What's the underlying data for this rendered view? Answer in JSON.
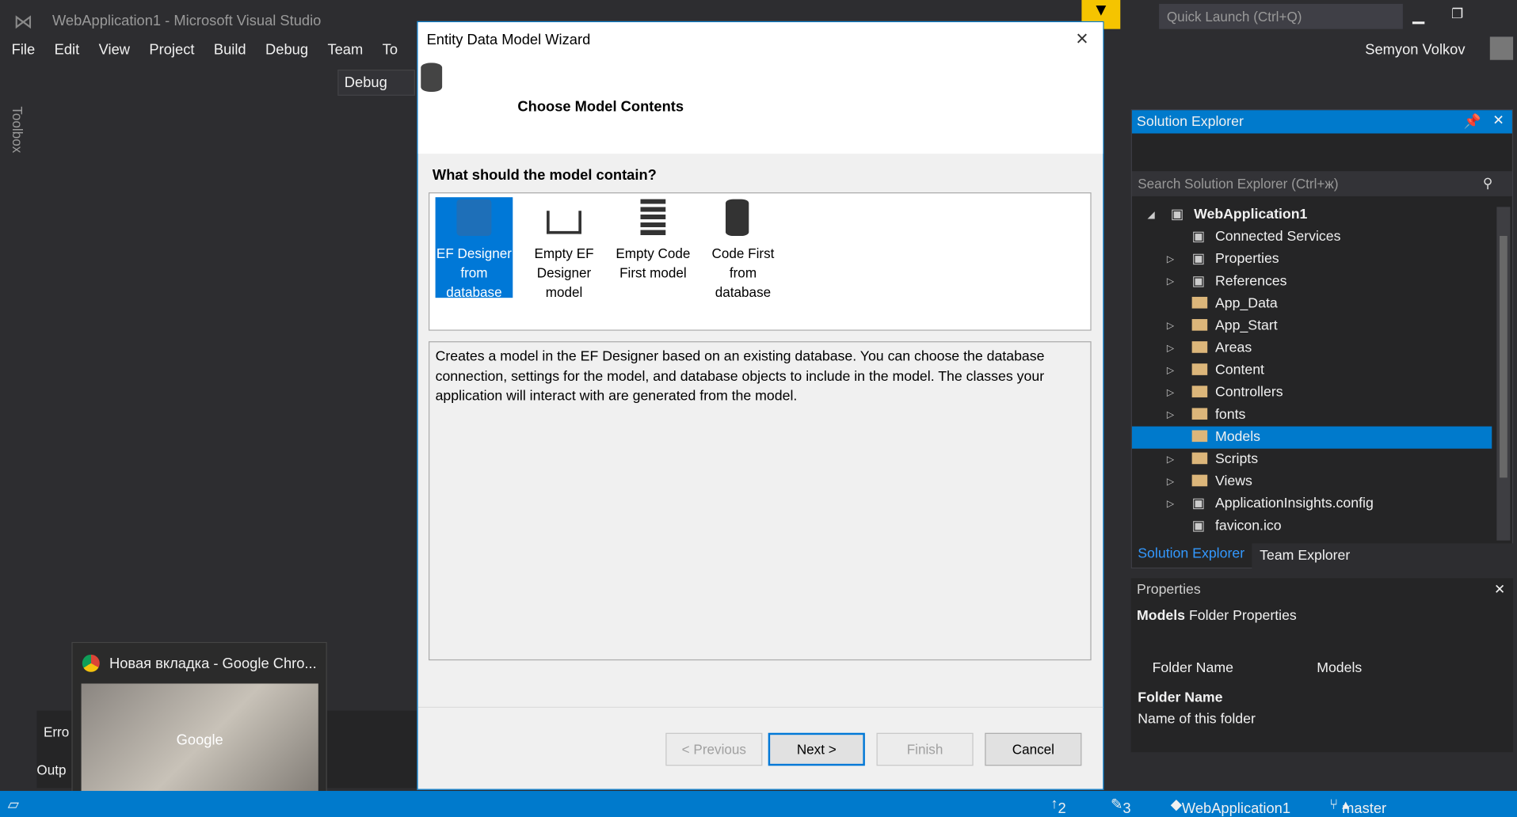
{
  "window": {
    "title": "WebApplication1 - Microsoft Visual Studio",
    "quick_launch": "Quick Launch (Ctrl+Q)",
    "user": "Semyon Volkov"
  },
  "menu": [
    "File",
    "Edit",
    "View",
    "Project",
    "Build",
    "Debug",
    "Team",
    "To"
  ],
  "toolbar": {
    "config": "Debug"
  },
  "toolbox_label": "Toolbox",
  "dialog": {
    "title": "Entity Data Model Wizard",
    "heading": "Choose Model Contents",
    "question": "What should the model contain?",
    "options": [
      {
        "label": "EF Designer from database",
        "selected": true,
        "icon": "database-designer-icon"
      },
      {
        "label": "Empty EF Designer model",
        "icon": "hierarchy-icon"
      },
      {
        "label": "Empty Code First model",
        "icon": "code-first-icon"
      },
      {
        "label": "Code First from database",
        "icon": "database-code-icon"
      }
    ],
    "description": "Creates a model in the EF Designer based on an existing database. You can choose the database connection, settings for the model, and database objects to include in the model. The classes your application will interact with are generated from the model.",
    "buttons": {
      "previous": "< Previous",
      "next": "Next >",
      "finish": "Finish",
      "cancel": "Cancel"
    }
  },
  "solution_explorer": {
    "title": "Solution Explorer",
    "search_placeholder": "Search Solution Explorer (Ctrl+ж)",
    "items": [
      {
        "label": "WebApplication1",
        "bold": true
      },
      {
        "label": "Connected Services"
      },
      {
        "label": "Properties"
      },
      {
        "label": "References"
      },
      {
        "label": "App_Data"
      },
      {
        "label": "App_Start"
      },
      {
        "label": "Areas"
      },
      {
        "label": "Content"
      },
      {
        "label": "Controllers"
      },
      {
        "label": "fonts"
      },
      {
        "label": "Models",
        "selected": true
      },
      {
        "label": "Scripts"
      },
      {
        "label": "Views"
      },
      {
        "label": "ApplicationInsights.config"
      },
      {
        "label": "favicon.ico"
      }
    ],
    "tabs": [
      "Solution Explorer",
      "Team Explorer"
    ]
  },
  "properties": {
    "title": "Properties",
    "object": "Models",
    "object_type": "Folder Properties",
    "rows": [
      {
        "name": "Folder Name",
        "value": "Models"
      }
    ],
    "desc_title": "Folder Name",
    "desc_text": "Name of this folder"
  },
  "bottom_panels": {
    "error": "Erro",
    "output": "Outp"
  },
  "taskbar_preview": {
    "title": "Новая вкладка - Google Chro...",
    "logo": "Google"
  },
  "statusbar": {
    "up": "2",
    "edits": "3",
    "project": "WebApplication1",
    "branch": "master"
  },
  "colors": {
    "accent": "#007acc",
    "selection": "#0078d7"
  }
}
